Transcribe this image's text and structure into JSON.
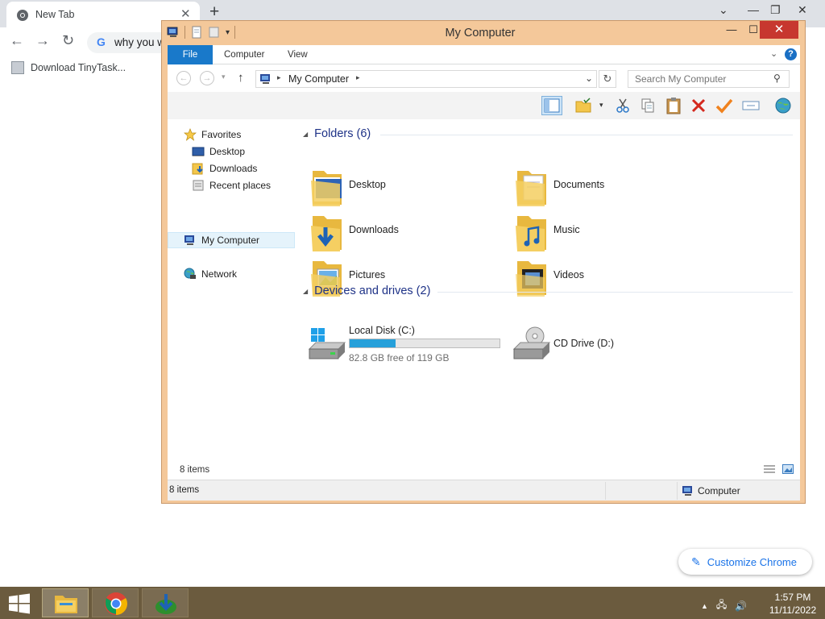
{
  "browser": {
    "tab_title": "New Tab",
    "omnibox_text": "why you w",
    "bookmark_label": "Download TinyTask...",
    "customize_label": "Customize Chrome"
  },
  "explorer": {
    "title": "My Computer",
    "ribbon_tabs": [
      "File",
      "Computer",
      "View"
    ],
    "address_location": "My Computer",
    "search_placeholder": "Search My Computer",
    "nav": {
      "favorites": "Favorites",
      "desktop": "Desktop",
      "downloads": "Downloads",
      "recent": "Recent places",
      "my_computer": "My Computer",
      "network": "Network"
    },
    "folders_header": "Folders (6)",
    "folders": [
      "Desktop",
      "Documents",
      "Downloads",
      "Music",
      "Pictures",
      "Videos"
    ],
    "devices_header": "Devices and drives (2)",
    "drives": {
      "c_label": "Local Disk (C:)",
      "c_free": "82.8 GB free of 119 GB",
      "c_used_fraction": 0.304,
      "d_label": "CD Drive (D:)"
    },
    "item_count": "8 items",
    "status_count": "8 items",
    "status_location": "Computer"
  },
  "taskbar": {
    "time": "1:57 PM",
    "date": "11/11/2022"
  },
  "colors": {
    "window_frame": "#f4c89a",
    "file_tab": "#1979ca",
    "close_button": "#c7372f",
    "taskbar": "#6b5b3e",
    "drive_bar": "#26a0da",
    "group_header": "#1e3287"
  }
}
